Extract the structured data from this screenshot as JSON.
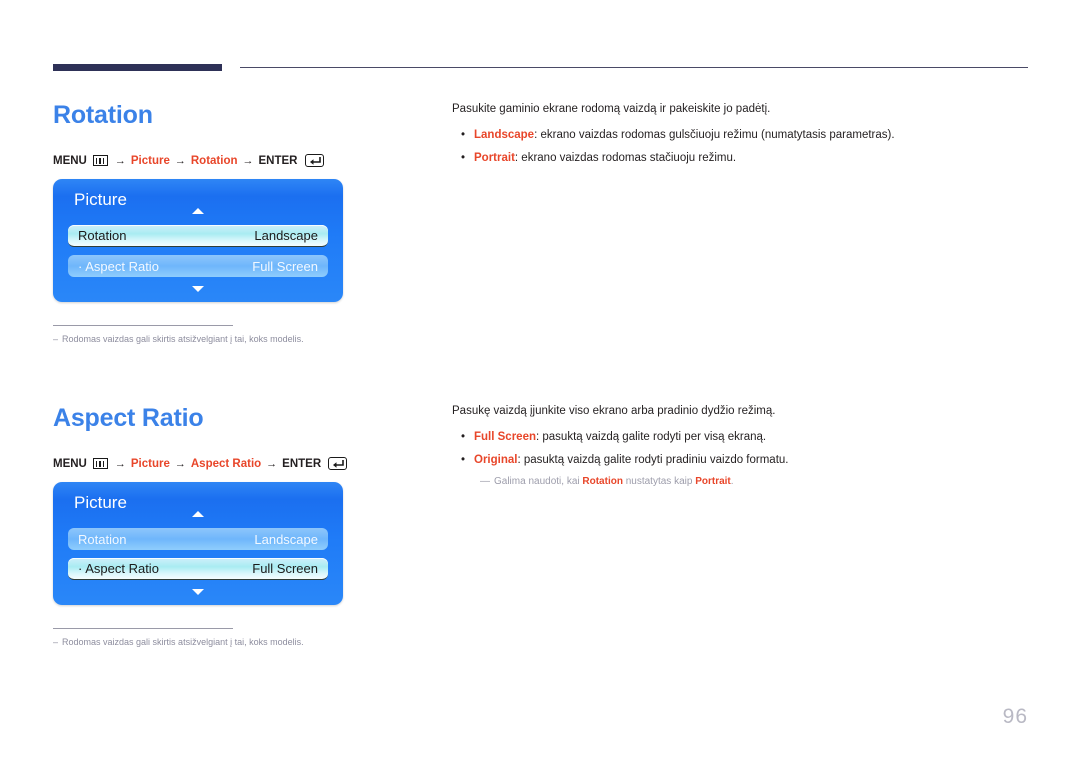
{
  "page": {
    "number": "96"
  },
  "sections": [
    {
      "title": "Rotation",
      "path": {
        "menu_label": "MENU",
        "menu_icon": "menu-grid-icon",
        "crumb1": "Picture",
        "crumb2": "Rotation",
        "enter_label": "ENTER",
        "enter_icon": "enter-return-icon",
        "arrow": "→"
      },
      "osd": {
        "title": "Picture",
        "up_arrow_icon": "chevron-up-icon",
        "down_arrow_icon": "chevron-down-icon",
        "rows": [
          {
            "label": "Rotation",
            "value": "Landscape",
            "selected": true
          },
          {
            "label": "· Aspect Ratio",
            "value": "Full Screen",
            "selected": false
          }
        ]
      },
      "note": "Rodomas vaizdas gali skirtis atsižvelgiant į tai, koks modelis.",
      "note_dash": "–",
      "body": {
        "lead": "Pasukite gaminio ekrane rodomą vaizdą ir pakeiskite jo padėtį.",
        "bullets": [
          {
            "dot": "•",
            "term": "Landscape",
            "text": ": ekrano vaizdas rodomas gulsčiuoju režimu (numatytasis parametras)."
          },
          {
            "dot": "•",
            "term": "Portrait",
            "text": ": ekrano vaizdas rodomas stačiuoju režimu."
          }
        ]
      }
    },
    {
      "title": "Aspect Ratio",
      "path": {
        "menu_label": "MENU",
        "menu_icon": "menu-grid-icon",
        "crumb1": "Picture",
        "crumb2": "Aspect Ratio",
        "enter_label": "ENTER",
        "enter_icon": "enter-return-icon",
        "arrow": "→"
      },
      "osd": {
        "title": "Picture",
        "up_arrow_icon": "chevron-up-icon",
        "down_arrow_icon": "chevron-down-icon",
        "rows": [
          {
            "label": "Rotation",
            "value": "Landscape",
            "selected": false
          },
          {
            "label": "· Aspect Ratio",
            "value": "Full Screen",
            "selected": true
          }
        ]
      },
      "note": "Rodomas vaizdas gali skirtis atsižvelgiant į tai, koks modelis.",
      "note_dash": "–",
      "body": {
        "lead": "Pasukę vaizdą įjunkite viso ekrano arba pradinio dydžio režimą.",
        "bullets": [
          {
            "dot": "•",
            "term": "Full Screen",
            "text": ": pasuktą vaizdą galite rodyti per visą ekraną."
          },
          {
            "dot": "•",
            "term": "Original",
            "text": ": pasuktą vaizdą galite rodyti pradiniu vaizdo formatu."
          }
        ],
        "subnote": {
          "dash": "—",
          "pre": "Galima naudoti, kai ",
          "term1": "Rotation",
          "mid": " nustatytas kaip ",
          "term2": "Portrait",
          "post": "."
        }
      }
    }
  ],
  "colors": {
    "heading_blue": "#3b82e8",
    "term_red": "#e8462a",
    "header_bar_navy": "#2e3157",
    "osd_blue": "#1f7bf7"
  }
}
